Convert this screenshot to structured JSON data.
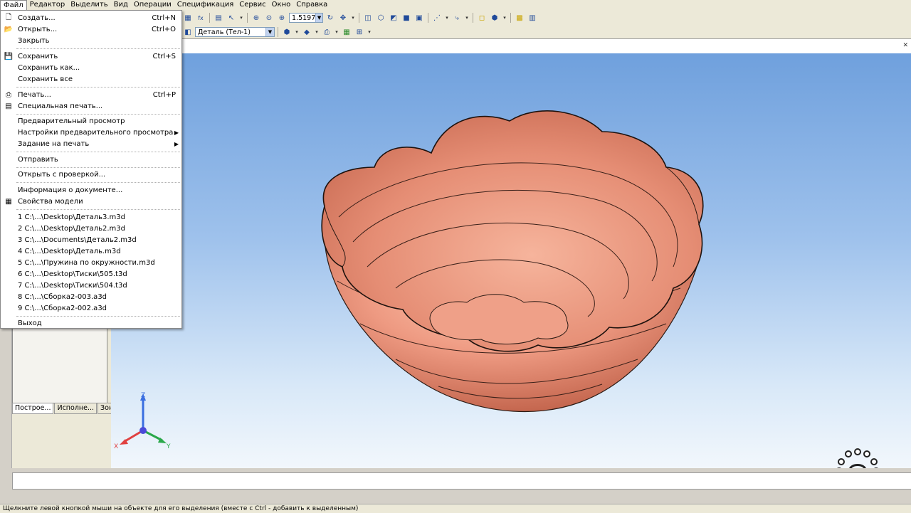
{
  "menubar": {
    "items": [
      "Файл",
      "Редактор",
      "Выделить",
      "Вид",
      "Операции",
      "Спецификация",
      "Сервис",
      "Окно",
      "Справка"
    ]
  },
  "toolbar": {
    "zoom_value": "1.5197",
    "part_combo": "Деталь (Тел-1)"
  },
  "file_menu": {
    "create": {
      "label": "Создать...",
      "shortcut": "Ctrl+N"
    },
    "open": {
      "label": "Открыть...",
      "shortcut": "Ctrl+O"
    },
    "close": {
      "label": "Закрыть"
    },
    "save": {
      "label": "Сохранить",
      "shortcut": "Ctrl+S"
    },
    "save_as": {
      "label": "Сохранить как..."
    },
    "save_all": {
      "label": "Сохранить все"
    },
    "print": {
      "label": "Печать...",
      "shortcut": "Ctrl+P"
    },
    "special_print": {
      "label": "Специальная печать..."
    },
    "preview": {
      "label": "Предварительный просмотр"
    },
    "preview_settings": {
      "label": "Настройки предварительного просмотра"
    },
    "print_job": {
      "label": "Задание на печать"
    },
    "send": {
      "label": "Отправить"
    },
    "open_check": {
      "label": "Открыть с проверкой..."
    },
    "doc_info": {
      "label": "Информация о документе..."
    },
    "model_props": {
      "label": "Свойства модели"
    },
    "recent": [
      "1 C:\\...\\Desktop\\Деталь3.m3d",
      "2 C:\\...\\Desktop\\Деталь2.m3d",
      "3 C:\\...\\Documents\\Деталь2.m3d",
      "4 C:\\...\\Desktop\\Деталь.m3d",
      "5 C:\\...\\Пружина по окружности.m3d",
      "6 C:\\...\\Desktop\\Тиски\\505.t3d",
      "7 C:\\...\\Desktop\\Тиски\\504.t3d",
      "8 C:\\...\\Сборка2-003.a3d",
      "9 C:\\...\\Сборка2-002.a3d"
    ],
    "exit": {
      "label": "Выход"
    }
  },
  "left_panel": {
    "tabs": [
      "Построе...",
      "Исполне...",
      "Зоны"
    ]
  },
  "axes": {
    "x": "X",
    "y": "Y",
    "z": "Z"
  },
  "status_text": "Щелкните левой кнопкой мыши на объекте для его выделения (вместе с Ctrl - добавить к выделенным)",
  "colors": {
    "model": "#e8907a",
    "background_top": "#6fa0dd",
    "background_bottom": "#f2f7fc"
  }
}
